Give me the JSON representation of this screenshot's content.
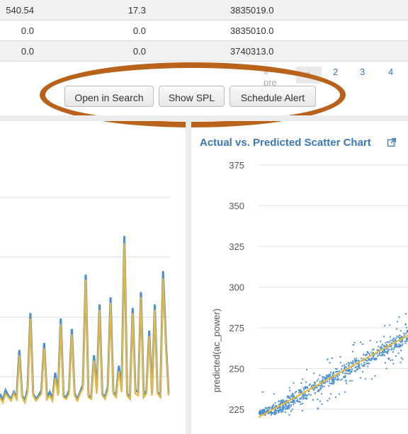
{
  "table": {
    "rows": [
      [
        "540.54",
        "17.3",
        "3835019.0"
      ],
      [
        "0.0",
        "0.0",
        "3835010.0"
      ],
      [
        "0.0",
        "0.0",
        "3740313.0"
      ]
    ]
  },
  "pagination": {
    "prev_label": "« pre",
    "pages": [
      "1",
      "2",
      "3",
      "4"
    ]
  },
  "buttons": {
    "open_in_search": "Open in Search",
    "show_spl": "Show SPL",
    "schedule_alert": "Schedule Alert"
  },
  "annotation": {
    "color": "#b8621b"
  },
  "line_chart": {
    "colors": {
      "actual": "#4b8fd0",
      "predicted": "#e8b83a"
    }
  },
  "scatter_chart": {
    "title": "Actual vs. Predicted Scatter Chart",
    "external_link_icon": "external-link-icon"
  },
  "chart_data": [
    {
      "type": "line",
      "series": [
        {
          "name": "",
          "values": [
            250,
            246,
            252,
            249,
            247,
            251,
            248,
            275,
            249,
            246,
            253,
            296,
            250,
            247,
            249,
            252,
            279,
            248,
            251,
            247,
            262,
            250,
            293,
            249,
            248,
            252,
            287,
            250,
            247,
            251,
            255,
            318,
            249,
            248,
            272,
            252,
            301,
            250,
            248,
            254,
            305,
            251,
            249,
            266,
            253,
            340,
            250,
            248,
            299,
            252,
            251,
            308,
            249,
            252,
            286,
            250,
            301,
            251,
            249,
            320,
            280,
            250
          ]
        },
        {
          "name": "",
          "values": [
            248,
            245,
            250,
            248,
            246,
            250,
            247,
            272,
            248,
            245,
            251,
            293,
            249,
            246,
            248,
            250,
            276,
            247,
            249,
            246,
            259,
            249,
            290,
            248,
            247,
            250,
            284,
            249,
            246,
            250,
            253,
            315,
            248,
            247,
            269,
            250,
            298,
            249,
            247,
            252,
            302,
            250,
            248,
            263,
            251,
            336,
            249,
            247,
            296,
            250,
            249,
            305,
            248,
            250,
            283,
            249,
            298,
            250,
            248,
            316,
            277,
            249
          ]
        }
      ]
    },
    {
      "type": "scatter",
      "title": "Actual vs. Predicted Scatter Chart",
      "ylabel": "predicted(ac_power)",
      "yticks": [
        225,
        250,
        275,
        300,
        325,
        350,
        375
      ],
      "ylim": [
        220,
        380
      ],
      "xlim": [
        220,
        280
      ],
      "points_sample": [
        [
          222,
          226
        ],
        [
          230,
          232
        ],
        [
          240,
          242
        ],
        [
          250,
          250
        ],
        [
          260,
          262
        ],
        [
          270,
          266
        ],
        [
          275,
          270
        ]
      ]
    }
  ]
}
